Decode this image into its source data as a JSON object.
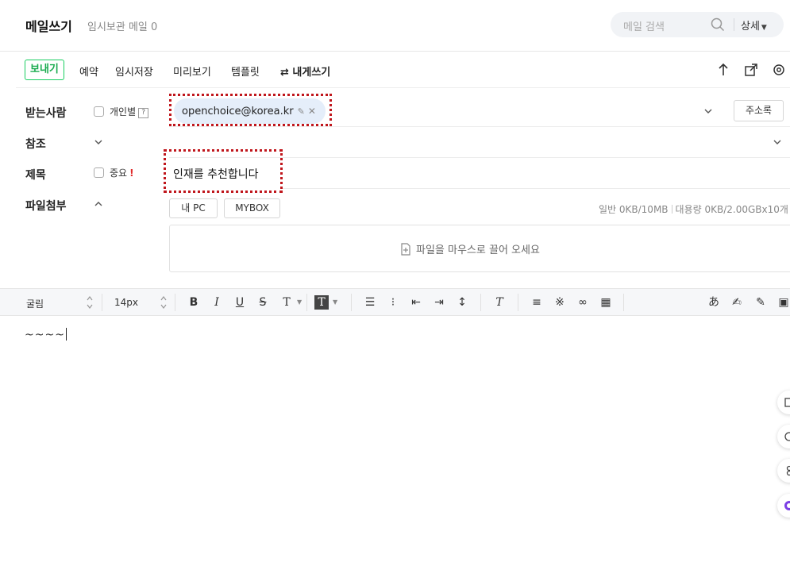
{
  "header": {
    "title": "메일쓰기",
    "draft_label": "임시보관 메일 0",
    "search_placeholder": "메일 검색",
    "detail_label": "상세"
  },
  "toolbar": {
    "send": "보내기",
    "schedule": "예약",
    "save_draft": "임시저장",
    "preview": "미리보기",
    "template": "템플릿",
    "write_to_self": "내게쓰기"
  },
  "form": {
    "to_label": "받는사람",
    "individual_label": "개인별",
    "help_badge": "?",
    "recipient": "openchoice@korea.kr",
    "address_book": "주소록",
    "cc_label": "참조",
    "subject_label": "제목",
    "important_label": "중요",
    "important_mark": "!",
    "subject_value": "인재를 추천합니다",
    "attach_label": "파일첨부",
    "my_pc": "내 PC",
    "mybox": "MYBOX",
    "quota_general": "일반 0KB/10MB",
    "quota_large": "대용량 0KB/2.00GBx10개",
    "drop_hint": "파일을 마우스로 끌어 오세요"
  },
  "editor": {
    "font_family": "굴림",
    "font_size": "14px",
    "body_text": "~~~~"
  },
  "colors": {
    "accent_green": "#19ce60",
    "highlight_dotted": "#c0161c",
    "chip_bg": "#e5eefa"
  }
}
